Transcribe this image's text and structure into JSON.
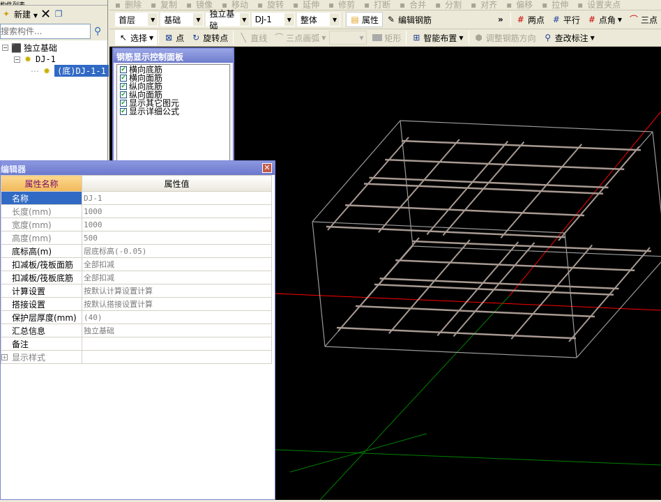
{
  "toolbar_top": [
    "删除",
    "复制",
    "镜像",
    "移动",
    "旋转",
    "延伸",
    "修剪",
    "打断",
    "合并",
    "分割",
    "对齐",
    "偏移",
    "拉伸",
    "设置夹点"
  ],
  "selectors": {
    "floor": "首层",
    "category": "基础",
    "type": "独立基础",
    "component": "DJ-1",
    "part": "整体"
  },
  "toolbar2": {
    "properties": "属性",
    "edit_rebar": "编辑钢筋",
    "more": "»",
    "two_points": "两点",
    "parallel": "平行",
    "point_angle": "点角",
    "three_points": "三点"
  },
  "toolbar3": {
    "select": "选择",
    "point": "点",
    "rotate_point": "旋转点",
    "line": "直线",
    "arc": "三点画弧",
    "rect": "矩形",
    "smart_layout": "智能布置",
    "adjust_direction": "调整钢筋方向",
    "edit_label": "查改标注"
  },
  "tree": {
    "title": "构件列表",
    "new": "新建",
    "search_placeholder": "搜索构件...",
    "root": "独立基础",
    "child": "DJ-1",
    "leaf": "(底)DJ-1-1"
  },
  "rebar_panel": {
    "title": "钢筋显示控制面板",
    "items": [
      {
        "label": "横向底筋",
        "checked": true
      },
      {
        "label": "横向面筋",
        "checked": true
      },
      {
        "label": "纵向底筋",
        "checked": true
      },
      {
        "label": "纵向面筋",
        "checked": true
      },
      {
        "label": "显示其它图元",
        "checked": true
      },
      {
        "label": "显示详细公式",
        "checked": true
      }
    ]
  },
  "editor": {
    "title": "编辑器",
    "col_name": "属性名称",
    "col_value": "属性值",
    "rows": [
      {
        "name": "名称",
        "value": "DJ-1"
      },
      {
        "name": "长度(mm)",
        "value": "1000"
      },
      {
        "name": "宽度(mm)",
        "value": "1000"
      },
      {
        "name": "高度(mm)",
        "value": "500"
      },
      {
        "name": "底标高(m)",
        "value": "层底标高(-0.05)"
      },
      {
        "name": "扣减板/筏板面筋",
        "value": "全部扣减"
      },
      {
        "name": "扣减板/筏板底筋",
        "value": "全部扣减"
      },
      {
        "name": "计算设置",
        "value": "按默认计算设置计算"
      },
      {
        "name": "搭接设置",
        "value": "按默认搭接设置计算"
      },
      {
        "name": "保护层厚度(mm)",
        "value": "(40)"
      },
      {
        "name": "汇总信息",
        "value": "独立基础"
      },
      {
        "name": "备注",
        "value": ""
      },
      {
        "name": "显示样式",
        "value": ""
      }
    ]
  },
  "colors": {
    "rebar": "#a89a92",
    "box": "#9a9a9a",
    "axis_x": "#ff0000",
    "axis_y": "#008000",
    "selection": "#316ac5"
  }
}
